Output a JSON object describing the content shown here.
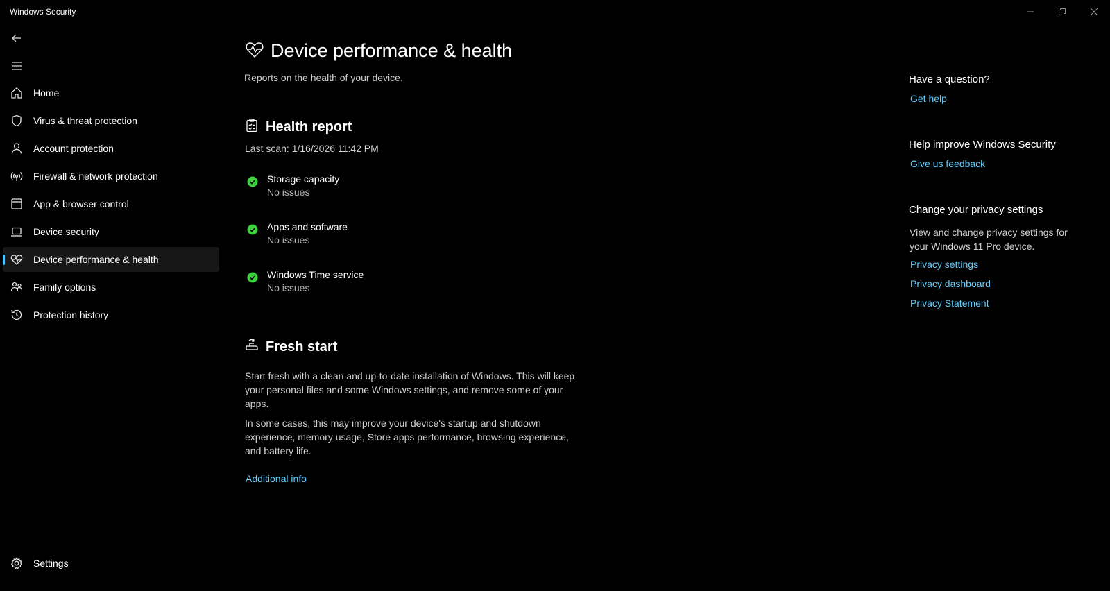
{
  "app": {
    "title": "Windows Security"
  },
  "sidebar": {
    "items": [
      {
        "label": "Home",
        "icon": "home-icon"
      },
      {
        "label": "Virus & threat protection",
        "icon": "shield-icon"
      },
      {
        "label": "Account protection",
        "icon": "person-icon"
      },
      {
        "label": "Firewall & network protection",
        "icon": "antenna-icon"
      },
      {
        "label": "App & browser control",
        "icon": "app-window-icon"
      },
      {
        "label": "Device security",
        "icon": "laptop-icon"
      },
      {
        "label": "Device performance & health",
        "icon": "heart-pulse-icon",
        "active": true
      },
      {
        "label": "Family options",
        "icon": "family-icon"
      },
      {
        "label": "Protection history",
        "icon": "history-icon"
      }
    ],
    "settings_label": "Settings"
  },
  "main": {
    "title": "Device performance & health",
    "subtitle": "Reports on the health of your device.",
    "health_report": {
      "title": "Health report",
      "last_scan": "Last scan: 1/16/2026 11:42 PM",
      "items": [
        {
          "title": "Storage capacity",
          "status": "No issues"
        },
        {
          "title": "Apps and software",
          "status": "No issues"
        },
        {
          "title": "Windows Time service",
          "status": "No issues"
        }
      ]
    },
    "fresh_start": {
      "title": "Fresh start",
      "para1": "Start fresh with a clean and up-to-date installation of Windows. This will keep your personal files and some Windows settings, and remove some of your apps.",
      "para2": "In some cases, this may improve your device's startup and shutdown experience, memory usage, Store apps performance, browsing experience, and battery life.",
      "link": "Additional info"
    }
  },
  "right_panel": {
    "question_heading": "Have a question?",
    "get_help": "Get help",
    "improve_heading": "Help improve Windows Security",
    "feedback": "Give us feedback",
    "privacy_heading": "Change your privacy settings",
    "privacy_text": "View and change privacy settings for your Windows 11 Pro device.",
    "privacy_links": [
      "Privacy settings",
      "Privacy dashboard",
      "Privacy Statement"
    ]
  },
  "colors": {
    "background": "#000000",
    "accent": "#4cc2ff",
    "link": "#60cdff",
    "success": "#3ed23e"
  }
}
